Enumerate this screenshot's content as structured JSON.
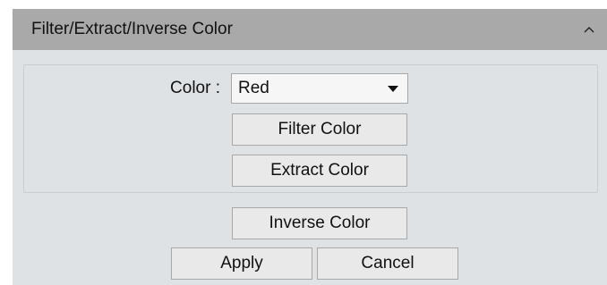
{
  "panel": {
    "title": "Filter/Extract/Inverse Color",
    "collapse_icon": "chevron-up-icon"
  },
  "color": {
    "label": "Color :",
    "selected": "Red"
  },
  "buttons": {
    "filter": "Filter Color",
    "extract": "Extract Color",
    "inverse": "Inverse Color",
    "apply": "Apply",
    "cancel": "Cancel"
  },
  "colors": {
    "header_bg": "#a9a9a9",
    "panel_bg": "#dfe2e4",
    "button_bg": "#e9e9e9"
  }
}
